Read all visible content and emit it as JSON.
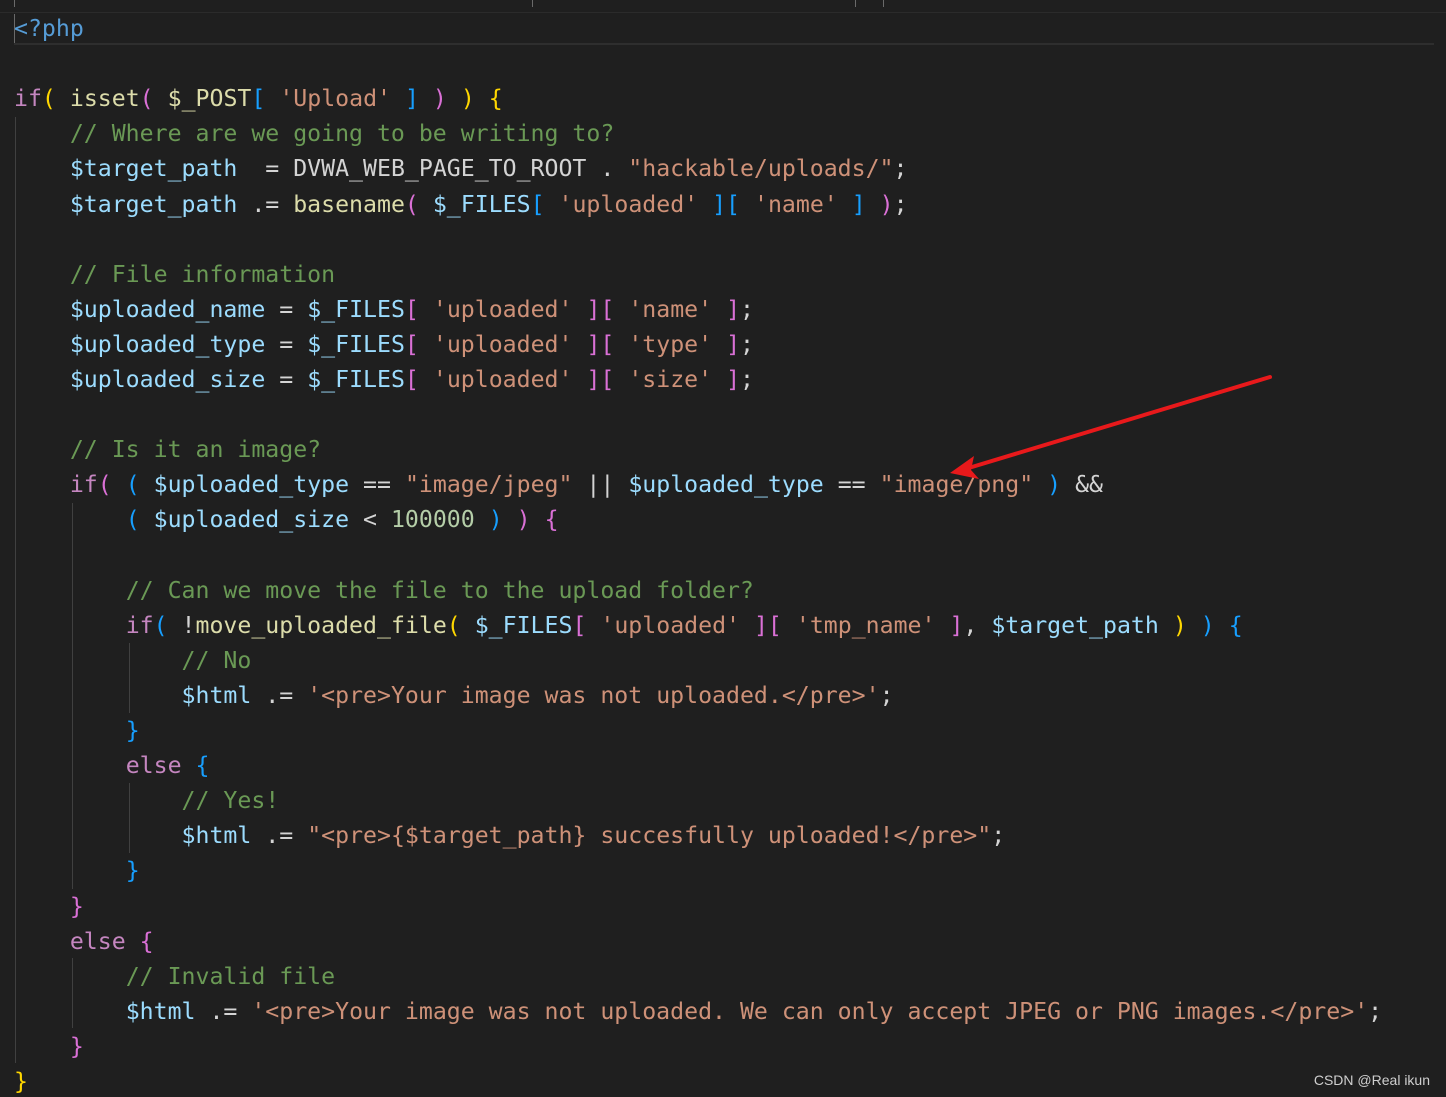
{
  "editor": {
    "lines": [
      [
        {
          "t": "<?php",
          "c": "tag"
        }
      ],
      [],
      [
        {
          "t": "if",
          "c": "kw"
        },
        {
          "t": "(",
          "c": "b1"
        },
        {
          "t": " ",
          "c": "op"
        },
        {
          "t": "isset",
          "c": "fn"
        },
        {
          "t": "(",
          "c": "b2"
        },
        {
          "t": " ",
          "c": "op"
        },
        {
          "t": "$_POST",
          "c": "fn"
        },
        {
          "t": "[",
          "c": "b3"
        },
        {
          "t": " ",
          "c": "op"
        },
        {
          "t": "'Upload'",
          "c": "str"
        },
        {
          "t": " ",
          "c": "op"
        },
        {
          "t": "]",
          "c": "b3"
        },
        {
          "t": " ",
          "c": "op"
        },
        {
          "t": ")",
          "c": "b2"
        },
        {
          "t": " ",
          "c": "op"
        },
        {
          "t": ")",
          "c": "b1"
        },
        {
          "t": " ",
          "c": "op"
        },
        {
          "t": "{",
          "c": "b1"
        }
      ],
      [
        {
          "t": "    ",
          "c": "op"
        },
        {
          "t": "// Where are we going to be writing to?",
          "c": "cmt"
        }
      ],
      [
        {
          "t": "    ",
          "c": "op"
        },
        {
          "t": "$target_path",
          "c": "var"
        },
        {
          "t": "  = ",
          "c": "op"
        },
        {
          "t": "DVWA_WEB_PAGE_TO_ROOT",
          "c": "const"
        },
        {
          "t": " . ",
          "c": "op"
        },
        {
          "t": "\"hackable/uploads/\"",
          "c": "str"
        },
        {
          "t": ";",
          "c": "op"
        }
      ],
      [
        {
          "t": "    ",
          "c": "op"
        },
        {
          "t": "$target_path",
          "c": "var"
        },
        {
          "t": " .= ",
          "c": "op"
        },
        {
          "t": "basename",
          "c": "fn"
        },
        {
          "t": "(",
          "c": "b2"
        },
        {
          "t": " ",
          "c": "op"
        },
        {
          "t": "$_FILES",
          "c": "var"
        },
        {
          "t": "[",
          "c": "b3"
        },
        {
          "t": " ",
          "c": "op"
        },
        {
          "t": "'uploaded'",
          "c": "str"
        },
        {
          "t": " ",
          "c": "op"
        },
        {
          "t": "][",
          "c": "b3"
        },
        {
          "t": " ",
          "c": "op"
        },
        {
          "t": "'name'",
          "c": "str"
        },
        {
          "t": " ",
          "c": "op"
        },
        {
          "t": "]",
          "c": "b3"
        },
        {
          "t": " ",
          "c": "op"
        },
        {
          "t": ")",
          "c": "b2"
        },
        {
          "t": ";",
          "c": "op"
        }
      ],
      [],
      [
        {
          "t": "    ",
          "c": "op"
        },
        {
          "t": "// File information",
          "c": "cmt"
        }
      ],
      [
        {
          "t": "    ",
          "c": "op"
        },
        {
          "t": "$uploaded_name",
          "c": "var"
        },
        {
          "t": " = ",
          "c": "op"
        },
        {
          "t": "$_FILES",
          "c": "var"
        },
        {
          "t": "[",
          "c": "b2"
        },
        {
          "t": " ",
          "c": "op"
        },
        {
          "t": "'uploaded'",
          "c": "str"
        },
        {
          "t": " ",
          "c": "op"
        },
        {
          "t": "][",
          "c": "b2"
        },
        {
          "t": " ",
          "c": "op"
        },
        {
          "t": "'name'",
          "c": "str"
        },
        {
          "t": " ",
          "c": "op"
        },
        {
          "t": "]",
          "c": "b2"
        },
        {
          "t": ";",
          "c": "op"
        }
      ],
      [
        {
          "t": "    ",
          "c": "op"
        },
        {
          "t": "$uploaded_type",
          "c": "var"
        },
        {
          "t": " = ",
          "c": "op"
        },
        {
          "t": "$_FILES",
          "c": "var"
        },
        {
          "t": "[",
          "c": "b2"
        },
        {
          "t": " ",
          "c": "op"
        },
        {
          "t": "'uploaded'",
          "c": "str"
        },
        {
          "t": " ",
          "c": "op"
        },
        {
          "t": "][",
          "c": "b2"
        },
        {
          "t": " ",
          "c": "op"
        },
        {
          "t": "'type'",
          "c": "str"
        },
        {
          "t": " ",
          "c": "op"
        },
        {
          "t": "]",
          "c": "b2"
        },
        {
          "t": ";",
          "c": "op"
        }
      ],
      [
        {
          "t": "    ",
          "c": "op"
        },
        {
          "t": "$uploaded_size",
          "c": "var"
        },
        {
          "t": " = ",
          "c": "op"
        },
        {
          "t": "$_FILES",
          "c": "var"
        },
        {
          "t": "[",
          "c": "b2"
        },
        {
          "t": " ",
          "c": "op"
        },
        {
          "t": "'uploaded'",
          "c": "str"
        },
        {
          "t": " ",
          "c": "op"
        },
        {
          "t": "][",
          "c": "b2"
        },
        {
          "t": " ",
          "c": "op"
        },
        {
          "t": "'size'",
          "c": "str"
        },
        {
          "t": " ",
          "c": "op"
        },
        {
          "t": "]",
          "c": "b2"
        },
        {
          "t": ";",
          "c": "op"
        }
      ],
      [],
      [
        {
          "t": "    ",
          "c": "op"
        },
        {
          "t": "// Is it an image?",
          "c": "cmt"
        }
      ],
      [
        {
          "t": "    ",
          "c": "op"
        },
        {
          "t": "if",
          "c": "kw"
        },
        {
          "t": "(",
          "c": "b2"
        },
        {
          "t": " ",
          "c": "op"
        },
        {
          "t": "(",
          "c": "b3"
        },
        {
          "t": " ",
          "c": "op"
        },
        {
          "t": "$uploaded_type",
          "c": "var"
        },
        {
          "t": " == ",
          "c": "op"
        },
        {
          "t": "\"image/jpeg\"",
          "c": "str"
        },
        {
          "t": " || ",
          "c": "op"
        },
        {
          "t": "$uploaded_type",
          "c": "var"
        },
        {
          "t": " == ",
          "c": "op"
        },
        {
          "t": "\"image/png\"",
          "c": "str"
        },
        {
          "t": " ",
          "c": "op"
        },
        {
          "t": ")",
          "c": "b3"
        },
        {
          "t": " &&",
          "c": "op"
        }
      ],
      [
        {
          "t": "        ",
          "c": "op"
        },
        {
          "t": "(",
          "c": "b3"
        },
        {
          "t": " ",
          "c": "op"
        },
        {
          "t": "$uploaded_size",
          "c": "var"
        },
        {
          "t": " < ",
          "c": "op"
        },
        {
          "t": "100000",
          "c": "num"
        },
        {
          "t": " ",
          "c": "op"
        },
        {
          "t": ")",
          "c": "b3"
        },
        {
          "t": " ",
          "c": "op"
        },
        {
          "t": ")",
          "c": "b2"
        },
        {
          "t": " ",
          "c": "op"
        },
        {
          "t": "{",
          "c": "b2"
        }
      ],
      [],
      [
        {
          "t": "        ",
          "c": "op"
        },
        {
          "t": "// Can we move the file to the upload folder?",
          "c": "cmt"
        }
      ],
      [
        {
          "t": "        ",
          "c": "op"
        },
        {
          "t": "if",
          "c": "kw"
        },
        {
          "t": "(",
          "c": "b3"
        },
        {
          "t": " !",
          "c": "op"
        },
        {
          "t": "move_uploaded_file",
          "c": "fn"
        },
        {
          "t": "(",
          "c": "b1"
        },
        {
          "t": " ",
          "c": "op"
        },
        {
          "t": "$_FILES",
          "c": "var"
        },
        {
          "t": "[",
          "c": "b2"
        },
        {
          "t": " ",
          "c": "op"
        },
        {
          "t": "'uploaded'",
          "c": "str"
        },
        {
          "t": " ",
          "c": "op"
        },
        {
          "t": "][",
          "c": "b2"
        },
        {
          "t": " ",
          "c": "op"
        },
        {
          "t": "'tmp_name'",
          "c": "str"
        },
        {
          "t": " ",
          "c": "op"
        },
        {
          "t": "]",
          "c": "b2"
        },
        {
          "t": ", ",
          "c": "op"
        },
        {
          "t": "$target_path",
          "c": "var"
        },
        {
          "t": " ",
          "c": "op"
        },
        {
          "t": ")",
          "c": "b1"
        },
        {
          "t": " ",
          "c": "op"
        },
        {
          "t": ")",
          "c": "b3"
        },
        {
          "t": " ",
          "c": "op"
        },
        {
          "t": "{",
          "c": "b3"
        }
      ],
      [
        {
          "t": "            ",
          "c": "op"
        },
        {
          "t": "// No",
          "c": "cmt"
        }
      ],
      [
        {
          "t": "            ",
          "c": "op"
        },
        {
          "t": "$html",
          "c": "var"
        },
        {
          "t": " .= ",
          "c": "op"
        },
        {
          "t": "'<pre>Your image was not uploaded.</pre>'",
          "c": "str"
        },
        {
          "t": ";",
          "c": "op"
        }
      ],
      [
        {
          "t": "        ",
          "c": "op"
        },
        {
          "t": "}",
          "c": "b3"
        }
      ],
      [
        {
          "t": "        ",
          "c": "op"
        },
        {
          "t": "else",
          "c": "kw"
        },
        {
          "t": " ",
          "c": "op"
        },
        {
          "t": "{",
          "c": "b3"
        }
      ],
      [
        {
          "t": "            ",
          "c": "op"
        },
        {
          "t": "// Yes!",
          "c": "cmt"
        }
      ],
      [
        {
          "t": "            ",
          "c": "op"
        },
        {
          "t": "$html",
          "c": "var"
        },
        {
          "t": " .= ",
          "c": "op"
        },
        {
          "t": "\"<pre>{$target_path} succesfully uploaded!</pre>\"",
          "c": "str"
        },
        {
          "t": ";",
          "c": "op"
        }
      ],
      [
        {
          "t": "        ",
          "c": "op"
        },
        {
          "t": "}",
          "c": "b3"
        }
      ],
      [
        {
          "t": "    ",
          "c": "op"
        },
        {
          "t": "}",
          "c": "b2"
        }
      ],
      [
        {
          "t": "    ",
          "c": "op"
        },
        {
          "t": "else",
          "c": "kw"
        },
        {
          "t": " ",
          "c": "op"
        },
        {
          "t": "{",
          "c": "b2"
        }
      ],
      [
        {
          "t": "        ",
          "c": "op"
        },
        {
          "t": "// Invalid file",
          "c": "cmt"
        }
      ],
      [
        {
          "t": "        ",
          "c": "op"
        },
        {
          "t": "$html",
          "c": "var"
        },
        {
          "t": " .= ",
          "c": "op"
        },
        {
          "t": "'<pre>Your image was not uploaded. We can only accept JPEG or PNG images.</pre>'",
          "c": "str"
        },
        {
          "t": ";",
          "c": "op"
        }
      ],
      [
        {
          "t": "    ",
          "c": "op"
        },
        {
          "t": "}",
          "c": "b2"
        }
      ],
      [
        {
          "t": "}",
          "c": "b1"
        }
      ]
    ],
    "colors": {
      "background": "#1f1f1f",
      "keyword": "#c586c0",
      "function": "#dcdcaa",
      "variable": "#9cdcfe",
      "string": "#ce9178",
      "comment": "#6a9955",
      "number": "#b5cea8",
      "tag": "#569cd6",
      "bracket1": "#ffd700",
      "bracket2": "#da70d6",
      "bracket3": "#179fff",
      "annotation_arrow": "#e8191b"
    }
  },
  "annotation": {
    "arrow_target": "image/png",
    "arrow_color": "#e8191b"
  },
  "watermark": {
    "text": "CSDN @Real  ikun"
  }
}
